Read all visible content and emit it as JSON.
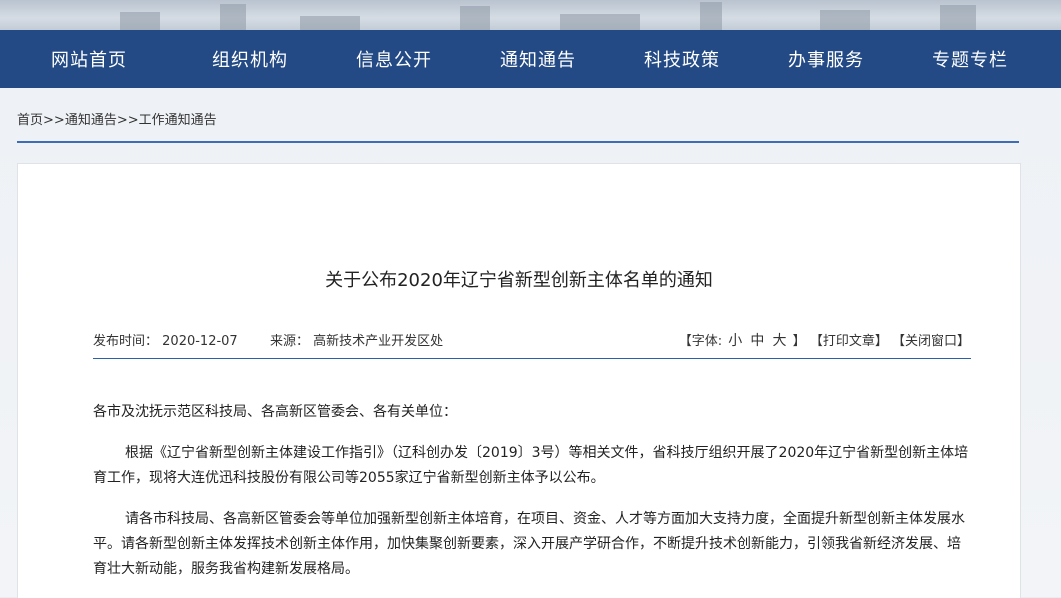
{
  "nav": {
    "items": [
      "网站首页",
      "组织机构",
      "信息公开",
      "通知通告",
      "科技政策",
      "办事服务",
      "专题专栏"
    ]
  },
  "breadcrumb": {
    "home": "首页",
    "sep1": ">>",
    "level1": "通知通告",
    "sep2": ">>",
    "level2": "工作通知通告"
  },
  "article": {
    "title": "关于公布2020年辽宁省新型创新主体名单的通知",
    "publish_label": "发布时间：",
    "publish_date": "2020-12-07",
    "source_label": "来源：",
    "source": "高新技术产业开发区处",
    "font_label": "【字体:",
    "font_small": "小",
    "font_medium": "中",
    "font_large": "大",
    "font_close": "】",
    "print": "【打印文章】",
    "close": "【关闭窗口】",
    "paragraphs": [
      "各市及沈抚示范区科技局、各高新区管委会、各有关单位：",
      "根据《辽宁省新型创新主体建设工作指引》（辽科创办发〔2019〕3号）等相关文件，省科技厅组织开展了2020年辽宁省新型创新主体培育工作，现将大连优迅科技股份有限公司等2055家辽宁省新型创新主体予以公布。",
      "请各市科技局、各高新区管委会等单位加强新型创新主体培育，在项目、资金、人才等方面加大支持力度，全面提升新型创新主体发展水平。请各新型创新主体发挥技术创新主体作用，加快集聚创新要素，深入开展产学研合作，不断提升技术创新能力，引领我省新经济发展、培育壮大新动能，服务我省构建新发展格局。"
    ]
  },
  "colors": {
    "nav_bg": "#234a84",
    "accent_line": "#3c6db5"
  }
}
